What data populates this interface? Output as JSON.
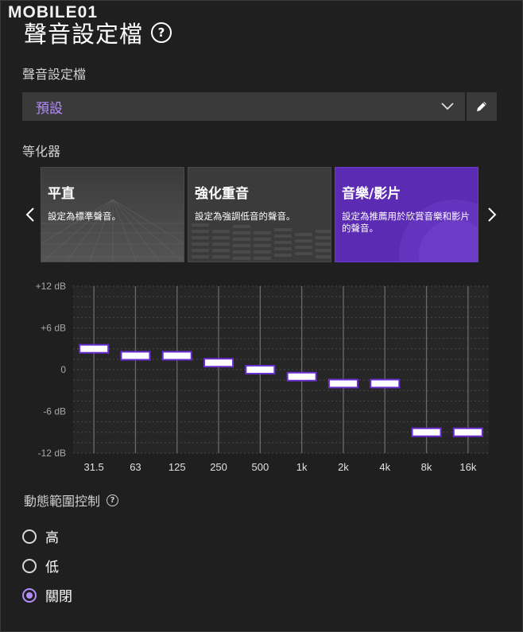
{
  "watermark": "MOBILE01",
  "page_title": "聲音設定檔",
  "profile_section": {
    "label": "聲音設定檔",
    "selected": "預設"
  },
  "equalizer": {
    "label": "等化器",
    "presets": [
      {
        "title": "平直",
        "desc": "設定為標準聲音。"
      },
      {
        "title": "強化重音",
        "desc": "設定為強調低音的聲音。"
      },
      {
        "title": "音樂/影片",
        "desc": "設定為推薦用於欣賞音樂和影片的聲音。",
        "selected": true
      }
    ]
  },
  "chart_data": {
    "type": "bar",
    "title": "",
    "xlabel": "",
    "ylabel": "",
    "ylim": [
      -12,
      12
    ],
    "y_ticks": [
      "+12 dB",
      "+6 dB",
      "0",
      "-6 dB",
      "-12 dB"
    ],
    "y_tick_values": [
      12,
      6,
      0,
      -6,
      -12
    ],
    "categories": [
      "31.5",
      "63",
      "125",
      "250",
      "500",
      "1k",
      "2k",
      "4k",
      "8k",
      "16k"
    ],
    "values": [
      3,
      2,
      2,
      1,
      0,
      -1,
      -2,
      -2,
      -9,
      -9
    ],
    "grid": true,
    "accent_color": "#6a2fd0"
  },
  "dynamic_range": {
    "label": "動態範圍控制",
    "options": [
      {
        "label": "高",
        "checked": false
      },
      {
        "label": "低",
        "checked": false
      },
      {
        "label": "關閉",
        "checked": true
      }
    ]
  },
  "colors": {
    "background": "#1f1f1f",
    "accent": "#b58cff",
    "selected_card": "#5b2bb3"
  }
}
